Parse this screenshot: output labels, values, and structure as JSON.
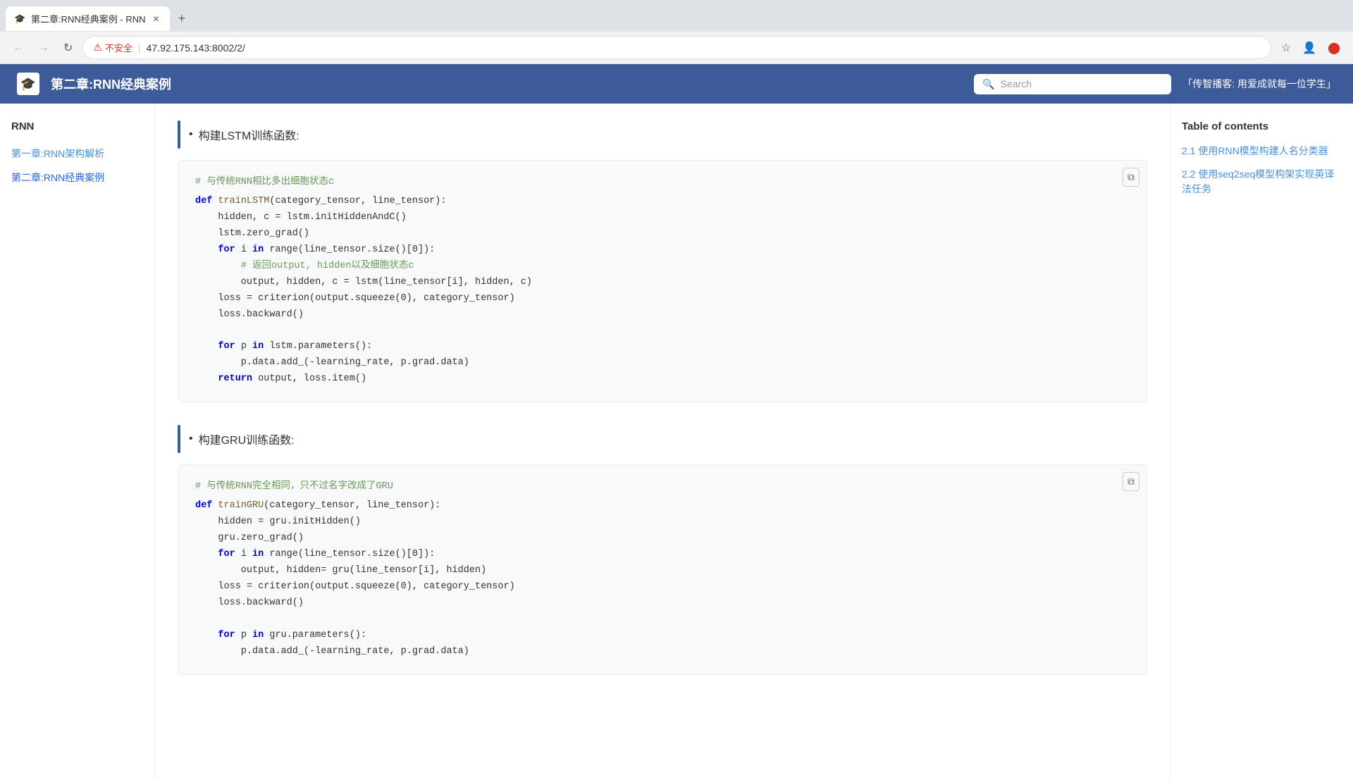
{
  "browser": {
    "tab_title": "第二章:RNN经典案例 - RNN",
    "new_tab_label": "+",
    "nav_back": "←",
    "nav_forward": "→",
    "nav_reload": "↻",
    "security_label": "不安全",
    "url": "47.92.175.143:8002/2/",
    "bookmark_icon": "☆",
    "account_icon": "👤",
    "close_icon": "✕"
  },
  "header": {
    "logo_icon": "🎓",
    "title": "第二章:RNN经典案例",
    "search_placeholder": "Search",
    "slogan": "「传智播客: 用爱成就每一位学生」"
  },
  "sidebar": {
    "title": "RNN",
    "links": [
      {
        "label": "第一章:RNN架构解析",
        "active": false
      },
      {
        "label": "第二章:RNN经典案例",
        "active": true
      }
    ]
  },
  "toc": {
    "title": "Table of contents",
    "items": [
      {
        "label": "2.1 使用RNN模型构建人名分类器"
      },
      {
        "label": "2.2 使用seq2seq模型构架实现英译法任务"
      }
    ]
  },
  "content": {
    "section1": {
      "bullet": "构建LSTM训练函数:",
      "comment1": "# 与传统RNN相比多出细胞状态c",
      "code1": "def trainLSTM(category_tensor, line_tensor):\n    hidden, c = lstm.initHiddenAndC()\n    lstm.zero_grad()\n    for i in range(line_tensor.size()[0]):\n        # 返回output, hidden以及细胞状态c\n        output, hidden, c = lstm(line_tensor[i], hidden, c)\n    loss = criterion(output.squeeze(0), category_tensor)\n    loss.backward()\n\n    for p in lstm.parameters():\n        p.data.add_(-learning_rate, p.grad.data)\n    return output, loss.item()"
    },
    "section2": {
      "bullet": "构建GRU训练函数:",
      "comment1": "# 与传统RNN完全相同，只不过名字改成了GRU",
      "code1": "def trainGRU(category_tensor, line_tensor):\n    hidden = gru.initHidden()\n    gru.zero_grad()\n    for i in range(line_tensor.size()[0]):\n        output, hidden= gru(line_tensor[i], hidden)\n    loss = criterion(output.squeeze(0), category_tensor)\n    loss.backward()\n\n    for p in gru.parameters():\n        p.data.add_(-learning_rate, p.grad.data)"
    }
  }
}
